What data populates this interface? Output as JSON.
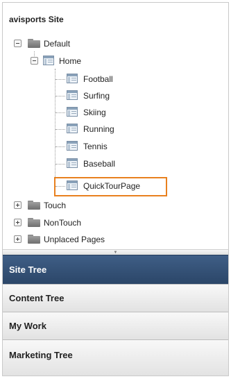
{
  "site": {
    "title": "avisports Site"
  },
  "tree": {
    "default_label": "Default",
    "home_label": "Home",
    "home_children": [
      "Football",
      "Surfing",
      "Skiing",
      "Running",
      "Tennis",
      "Baseball",
      "QuickTourPage"
    ],
    "touch_label": "Touch",
    "nontouch_label": "NonTouch",
    "unplaced_label": "Unplaced Pages",
    "highlight_color": "#e8801e"
  },
  "splitter": {
    "grip": "▼"
  },
  "accordion": {
    "site_tree": "Site Tree",
    "content_tree": "Content Tree",
    "my_work": "My Work",
    "marketing_tree": "Marketing Tree",
    "active_color": "#35547b"
  }
}
